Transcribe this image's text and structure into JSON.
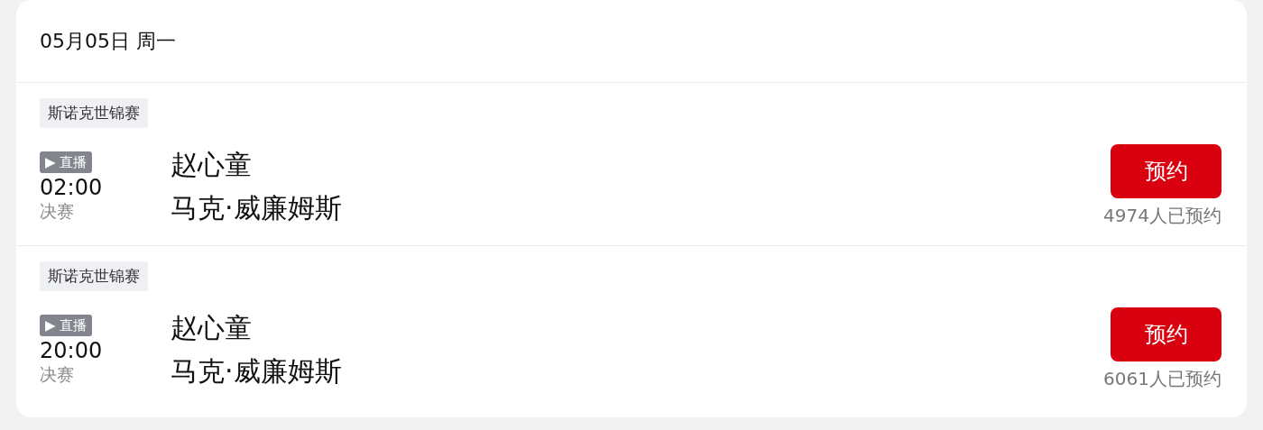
{
  "date_header": "05月05日 周一",
  "matches": [
    {
      "league": "斯诺克世锦赛",
      "live_badge": {
        "icon": "▶",
        "label": "直播"
      },
      "time": "02:00",
      "stage": "决赛",
      "players": [
        "赵心童",
        "马克·威廉姆斯"
      ],
      "button": "预约",
      "booked_count": "4974人已预约"
    },
    {
      "league": "斯诺克世锦赛",
      "live_badge": {
        "icon": "▶",
        "label": "直播"
      },
      "time": "20:00",
      "stage": "决赛",
      "players": [
        "赵心童",
        "马克·威廉姆斯"
      ],
      "button": "预约",
      "booked_count": "6061人已预约"
    }
  ]
}
